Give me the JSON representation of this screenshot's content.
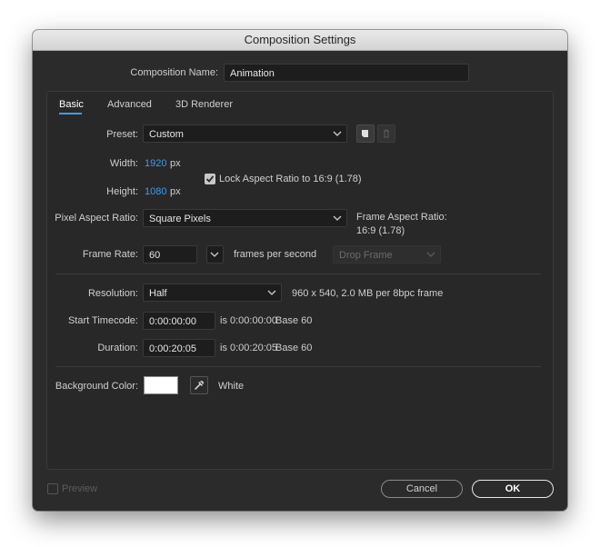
{
  "dialog": {
    "title": "Composition Settings",
    "name_label": "Composition Name:",
    "name_value": "Animation"
  },
  "tabs": [
    {
      "label": "Basic",
      "active": true
    },
    {
      "label": "Advanced",
      "active": false
    },
    {
      "label": "3D Renderer",
      "active": false
    }
  ],
  "preset": {
    "label": "Preset:",
    "value": "Custom"
  },
  "width": {
    "label": "Width:",
    "value": "1920",
    "unit": "px"
  },
  "height": {
    "label": "Height:",
    "value": "1080",
    "unit": "px"
  },
  "lock_aspect": {
    "label": "Lock Aspect Ratio to 16:9 (1.78)",
    "checked": true
  },
  "pixel_aspect": {
    "label": "Pixel Aspect Ratio:",
    "value": "Square Pixels"
  },
  "frame_aspect": {
    "label": "Frame Aspect Ratio:",
    "value": "16:9 (1.78)"
  },
  "frame_rate": {
    "label": "Frame Rate:",
    "value": "60",
    "unit": "frames per second",
    "drop_frame": "Drop Frame"
  },
  "resolution": {
    "label": "Resolution:",
    "value": "Half",
    "info": "960 x 540, 2.0 MB per 8bpc frame"
  },
  "start_timecode": {
    "label": "Start Timecode:",
    "value": "0:00:00:00",
    "info": "is 0:00:00:00",
    "base": "Base 60"
  },
  "duration": {
    "label": "Duration:",
    "value": "0:00:20:05",
    "info": "is 0:00:20:05",
    "base": "Base 60"
  },
  "background": {
    "label": "Background Color:",
    "color_name": "White",
    "color": "#ffffff"
  },
  "footer": {
    "preview_label": "Preview",
    "preview_checked": false,
    "cancel_label": "Cancel",
    "ok_label": "OK"
  },
  "colors": {
    "accent": "#3d9bf0",
    "dialog_bg": "#2b2b2b"
  }
}
